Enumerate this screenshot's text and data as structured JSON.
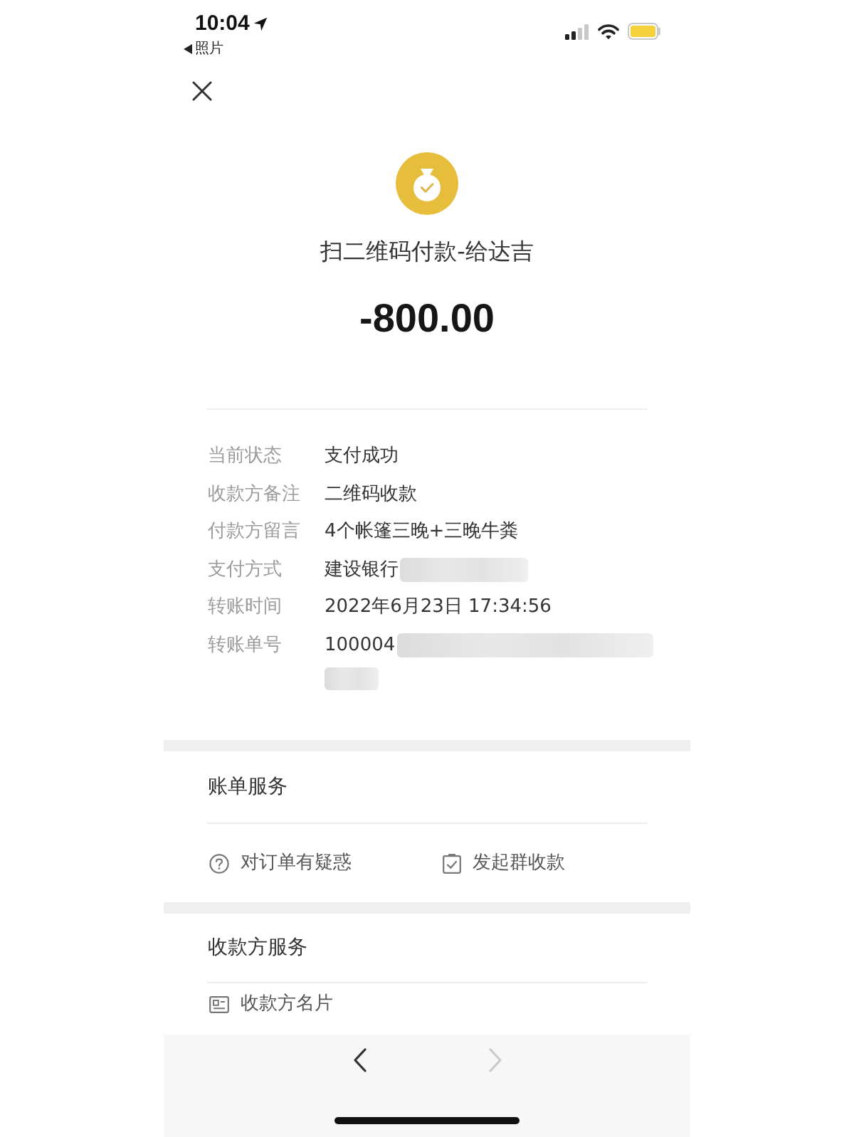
{
  "status_bar": {
    "time": "10:04",
    "back_app": "照片"
  },
  "header": {
    "title": "扫二维码付款-给达吉",
    "amount": "-800.00"
  },
  "details": [
    {
      "label": "当前状态",
      "value": "支付成功",
      "kind": "text"
    },
    {
      "label": "收款方备注",
      "value": "二维码收款",
      "kind": "text"
    },
    {
      "label": "付款方留言",
      "value": "4个帐篷三晚+三晚牛粪",
      "kind": "text"
    },
    {
      "label": "支付方式",
      "value": "建设银行",
      "kind": "masked"
    },
    {
      "label": "转账时间",
      "value": "2022年6月23日 17:34:56",
      "kind": "text"
    },
    {
      "label": "转账单号",
      "value": "100004",
      "kind": "masked_wrapped"
    }
  ],
  "bill_services": {
    "title": "账单服务",
    "actions": [
      {
        "kind": "question",
        "label": "对订单有疑惑"
      },
      {
        "kind": "group_collect",
        "label": "发起群收款"
      }
    ]
  },
  "payee_services": {
    "title": "收款方服务",
    "items": [
      {
        "kind": "card",
        "label": "收款方名片"
      }
    ]
  },
  "toolbar": {
    "buttons": [
      {
        "kind": "back",
        "disabled": false
      },
      {
        "kind": "forward",
        "disabled": true
      }
    ]
  }
}
